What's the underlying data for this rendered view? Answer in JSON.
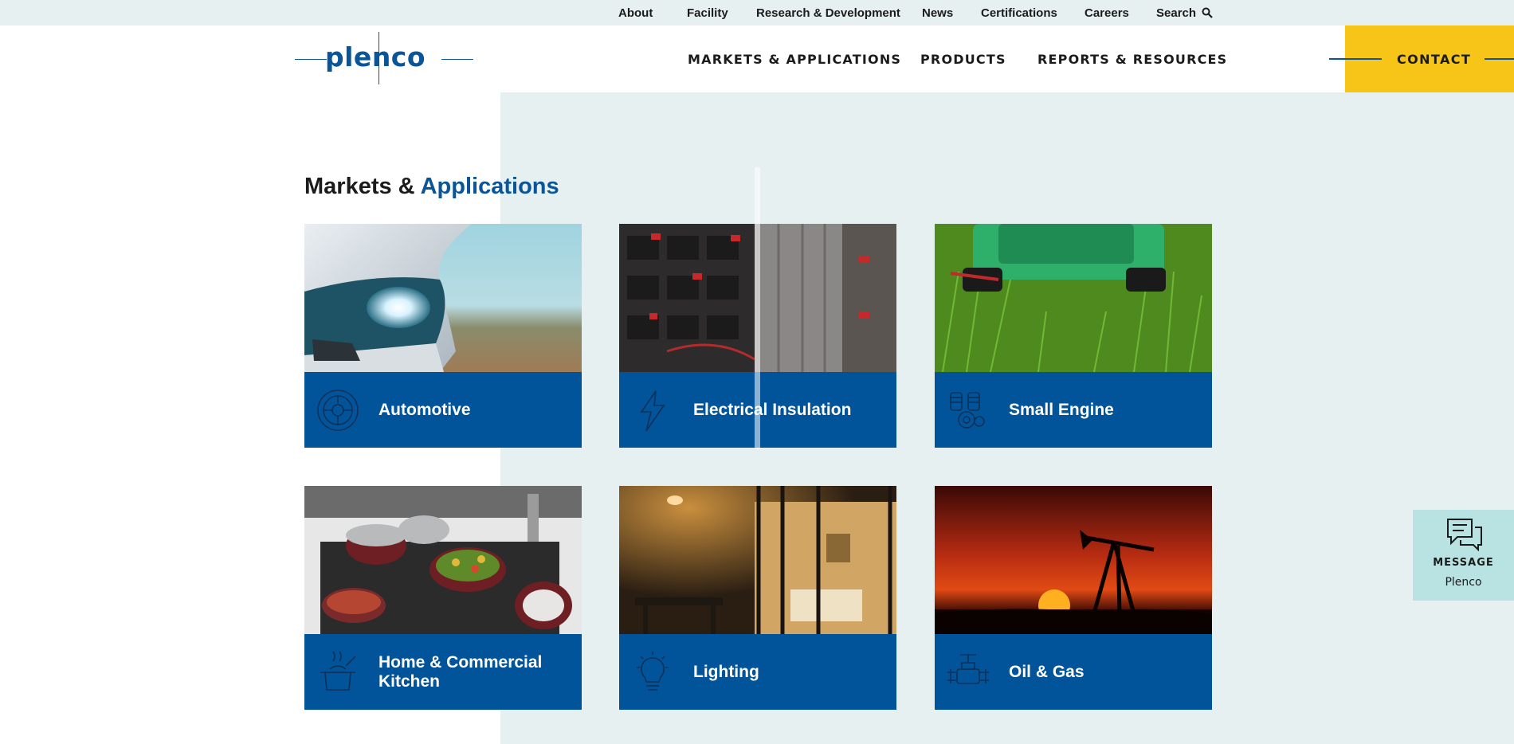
{
  "utility_nav": {
    "about": "About",
    "facility": "Facility",
    "research": "Research & Development",
    "news": "News",
    "certifications": "Certifications",
    "careers": "Careers",
    "search": "Search",
    "search_icon": "search-icon"
  },
  "brand": {
    "name": "plenco",
    "color": "#0a5598"
  },
  "main_nav": {
    "markets": "MARKETS & APPLICATIONS",
    "products": "PRODUCTS",
    "reports": "REPORTS & RESOURCES",
    "contact": "CONTACT"
  },
  "section": {
    "title_part1": "Markets & ",
    "title_part2": "Applications"
  },
  "cards": [
    {
      "label": "Automotive",
      "icon": "tire-icon"
    },
    {
      "label": "Electrical Insulation",
      "icon": "lightning-bolt-icon"
    },
    {
      "label": "Small Engine",
      "icon": "engine-icon"
    },
    {
      "label": "Home & Commercial Kitchen",
      "icon": "cooking-pot-icon"
    },
    {
      "label": "Lighting",
      "icon": "light-bulb-icon"
    },
    {
      "label": "Oil & Gas",
      "icon": "valve-icon"
    }
  ],
  "message_widget": {
    "title": "MESSAGE",
    "subtitle": "Plenco",
    "icon": "chat-bubbles-icon"
  },
  "colors": {
    "primary_blue": "#02549a",
    "accent_yellow": "#f7c518",
    "panel_bg": "#e6f0f0",
    "widget_bg": "#b9e3e2"
  }
}
